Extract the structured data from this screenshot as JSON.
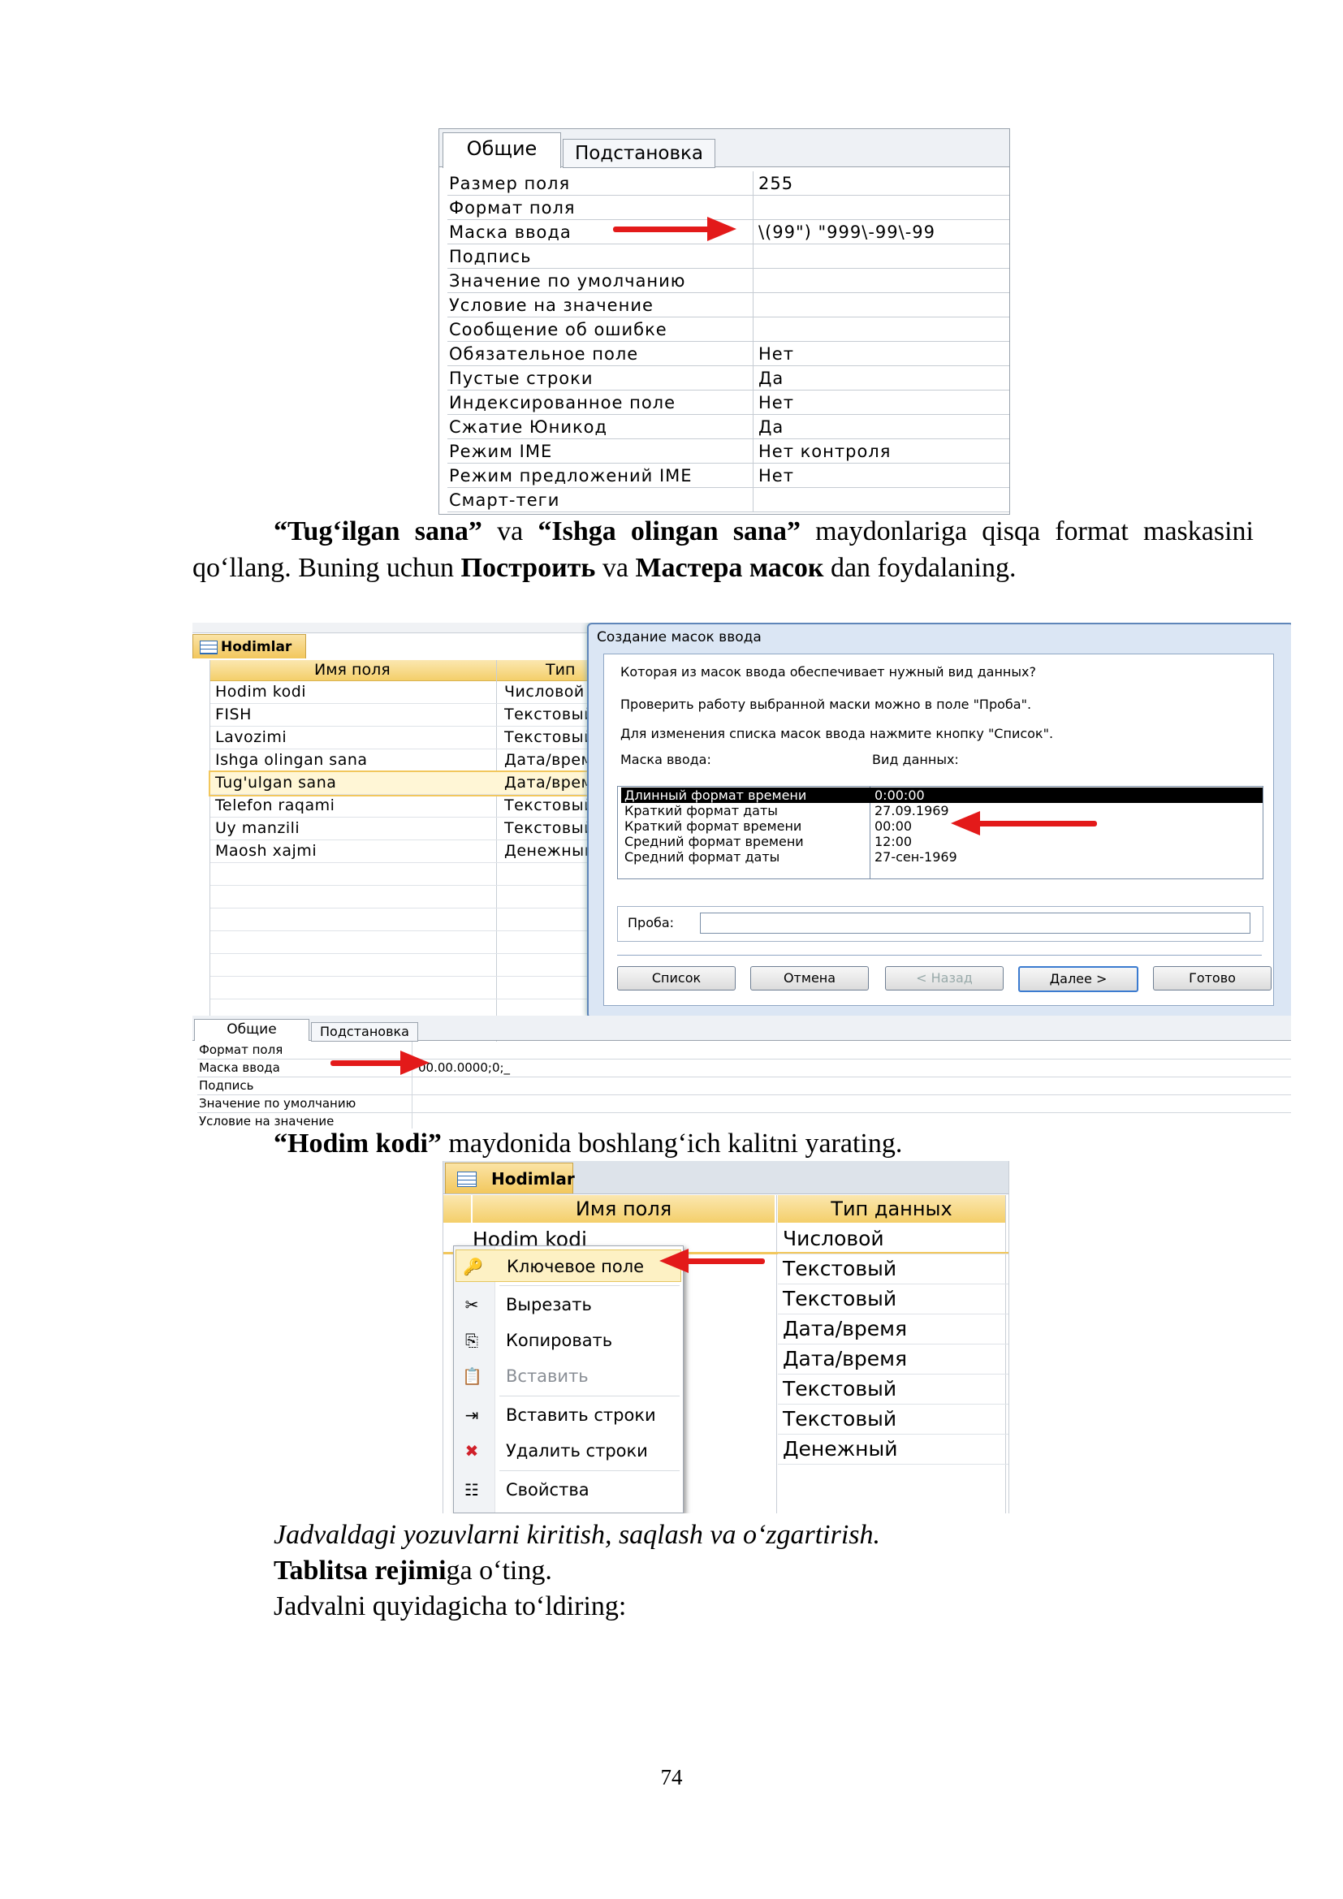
{
  "figure1": {
    "tabs": [
      "Общие",
      "Подстановка"
    ],
    "properties": [
      {
        "label": "Размер поля",
        "value": "255"
      },
      {
        "label": "Формат поля",
        "value": ""
      },
      {
        "label": "Маска ввода",
        "value": "\\(99\") \"999\\-99\\-99"
      },
      {
        "label": "Подпись",
        "value": ""
      },
      {
        "label": "Значение по умолчанию",
        "value": ""
      },
      {
        "label": "Условие на значение",
        "value": ""
      },
      {
        "label": "Сообщение об ошибке",
        "value": ""
      },
      {
        "label": "Обязательное поле",
        "value": "Нет"
      },
      {
        "label": "Пустые строки",
        "value": "Да"
      },
      {
        "label": "Индексированное поле",
        "value": "Нет"
      },
      {
        "label": "Сжатие Юникод",
        "value": "Да"
      },
      {
        "label": "Режим IME",
        "value": "Нет контроля"
      },
      {
        "label": "Режим предложений IME",
        "value": "Нет"
      },
      {
        "label": "Смарт-теги",
        "value": ""
      }
    ]
  },
  "paragraph1": {
    "q1": "“Tugʻilgan sana”",
    "t1": " va ",
    "q2": "“Ishga olingan sana”",
    "t2": " maydonlariga qisqa format maskasini qoʻllang. Buning uchun ",
    "b1": "Построить",
    "t3": " va ",
    "b2": "Мастера масок",
    "t4": " dan foydalaning."
  },
  "figure2": {
    "table_tab": "Hodimlar",
    "col_name": "Имя поля",
    "col_type": "Тип",
    "fields": [
      {
        "name": "Hodim kodi",
        "type": "Числовой"
      },
      {
        "name": "FISH",
        "type": "Текстовый"
      },
      {
        "name": "Lavozimi",
        "type": "Текстовый"
      },
      {
        "name": "Ishga olingan sana",
        "type": "Дата/время"
      },
      {
        "name": "Tug'ulgan sana",
        "type": "Дата/время"
      },
      {
        "name": "Telefon raqami",
        "type": "Текстовый"
      },
      {
        "name": "Uy manzili",
        "type": "Текстовый"
      },
      {
        "name": "Maosh xajmi",
        "type": "Денежный"
      }
    ],
    "dialog": {
      "title": "Создание масок ввода",
      "question": "Которая из масок ввода обеспечивает нужный вид данных?",
      "hint1": "Проверить работу выбранной маски можно в поле \"Проба\".",
      "hint2": "Для изменения списка масок ввода нажмите кнопку \"Список\".",
      "col_mask": "Маска ввода:",
      "col_view": "Вид данных:",
      "masks": [
        {
          "name": "Длинный формат времени",
          "view": "0:00:00"
        },
        {
          "name": "Краткий формат даты",
          "view": "27.09.1969"
        },
        {
          "name": "Краткий формат времени",
          "view": "00:00"
        },
        {
          "name": "Средний формат времени",
          "view": "12:00"
        },
        {
          "name": "Средний формат даты",
          "view": "27-сен-1969"
        }
      ],
      "proba_label": "Проба:",
      "proba_value": "",
      "buttons": {
        "list": "Список",
        "cancel": "Отмена",
        "back": "< Назад",
        "next": "Далее >",
        "finish": "Готово"
      }
    },
    "prop_tabs": [
      "Общие",
      "Подстановка"
    ],
    "props": [
      {
        "label": "Формат поля",
        "value": ""
      },
      {
        "label": "Маска ввода",
        "value": "00.00.0000;0;_"
      },
      {
        "label": "Подпись",
        "value": ""
      },
      {
        "label": "Значение по умолчанию",
        "value": ""
      },
      {
        "label": "Условие на значение",
        "value": ""
      }
    ]
  },
  "paragraph2": {
    "q": "“Hodim kodi”",
    "t": " maydonida boshlangʻich kalitni yarating."
  },
  "figure3": {
    "table_tab": "Hodimlar",
    "col_name": "Имя поля",
    "col_type": "Тип данных",
    "first_field": "Hodim kodi",
    "types": [
      "Числовой",
      "Текстовый",
      "Текстовый",
      "Дата/время",
      "Дата/время",
      "Текстовый",
      "Текстовый",
      "Денежный"
    ],
    "menu": [
      {
        "label": "Ключевое поле",
        "icon": "key-icon",
        "glyph": "🔑"
      },
      {
        "label": "Вырезать",
        "icon": "scissors-icon",
        "glyph": "✂"
      },
      {
        "label": "Копировать",
        "icon": "copy-icon",
        "glyph": "⎘"
      },
      {
        "label": "Вставить",
        "icon": "paste-icon",
        "glyph": "📋"
      },
      {
        "label": "Вставить строки",
        "icon": "insert-rows-icon",
        "glyph": "⇥"
      },
      {
        "label": "Удалить строки",
        "icon": "delete-rows-icon",
        "glyph": "✖"
      },
      {
        "label": "Свойства",
        "icon": "properties-icon",
        "glyph": "☷"
      }
    ]
  },
  "paragraph3": "Jadvaldagi yozuvlarni kiritish, saqlash va oʻzgartirish.",
  "paragraph4": {
    "b": "Tablitsa rejimi",
    "t": "ga oʻting."
  },
  "paragraph5": "Jadvalni quyidagicha toʻldiring:",
  "page_number": "74",
  "colors": {
    "arrow": "#e31a1a",
    "tab_gold": "#f2c75c",
    "dialog_bg": "#dbe6f4"
  }
}
